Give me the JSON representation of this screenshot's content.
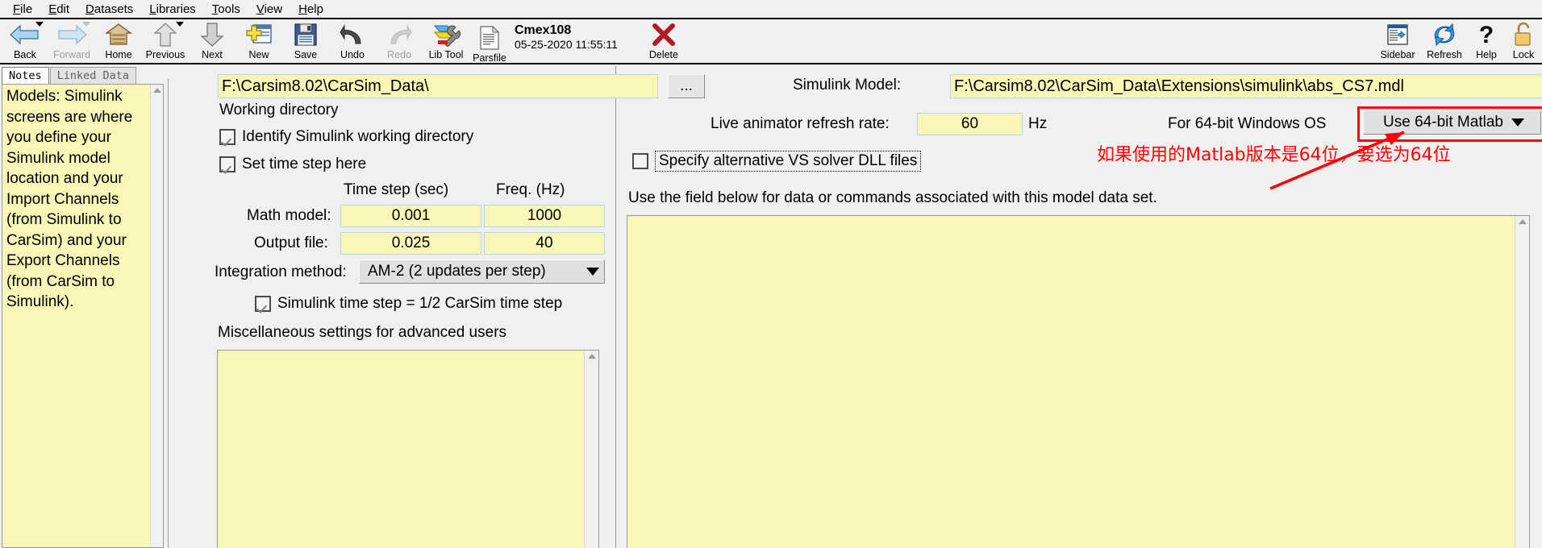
{
  "menu": {
    "items": [
      {
        "label": "File",
        "mnemonic": "F"
      },
      {
        "label": "Edit",
        "mnemonic": "E"
      },
      {
        "label": "Datasets",
        "mnemonic": "D"
      },
      {
        "label": "Libraries",
        "mnemonic": "L"
      },
      {
        "label": "Tools",
        "mnemonic": "T"
      },
      {
        "label": "View",
        "mnemonic": "V"
      },
      {
        "label": "Help",
        "mnemonic": "H"
      }
    ]
  },
  "toolbar": {
    "buttons": [
      {
        "label": "Back",
        "icon": "back-arrow-icon",
        "enabled": true,
        "caret": true
      },
      {
        "label": "Forward",
        "icon": "forward-arrow-icon",
        "enabled": false,
        "caret": true
      },
      {
        "label": "Home",
        "icon": "home-icon",
        "enabled": true,
        "caret": false
      },
      {
        "label": "Previous",
        "icon": "up-arrow-icon",
        "enabled": true,
        "caret": true
      },
      {
        "label": "Next",
        "icon": "down-arrow-icon",
        "enabled": true,
        "caret": false
      },
      {
        "label": "New",
        "icon": "new-dataset-icon",
        "enabled": true,
        "caret": false
      },
      {
        "label": "Save",
        "icon": "floppy-disk-icon",
        "enabled": true,
        "caret": false
      },
      {
        "label": "Undo",
        "icon": "undo-arrow-icon",
        "enabled": true,
        "caret": false
      },
      {
        "label": "Redo",
        "icon": "redo-arrow-icon",
        "enabled": false,
        "caret": false
      },
      {
        "label": "Lib Tool",
        "icon": "library-tool-icon",
        "enabled": true,
        "caret": false
      }
    ],
    "parsfile": {
      "label": "Parsfile",
      "icon": "document-icon",
      "name": "Cmex108",
      "date": "05-25-2020 11:55:11"
    },
    "delete": {
      "label": "Delete",
      "icon": "red-x-icon"
    },
    "right_buttons": [
      {
        "label": "Sidebar",
        "icon": "sidebar-icon"
      },
      {
        "label": "Refresh",
        "icon": "refresh-icon"
      },
      {
        "label": "Help",
        "icon": "question-mark-icon"
      },
      {
        "label": "Lock",
        "icon": "padlock-open-icon"
      }
    ]
  },
  "notes": {
    "tabs": [
      {
        "label": "Notes",
        "active": true
      },
      {
        "label": "Linked Data",
        "active": false
      }
    ],
    "text": "Models: Simulink screens are where you define your Simulink model location and your Import Channels (from Simulink to CarSim) and your Export Channels (from CarSim to Simulink)."
  },
  "left_panel": {
    "working_directory": {
      "value": "F:\\Carsim8.02\\CarSim_Data\\",
      "caption": "Working directory",
      "browse_label": "..."
    },
    "identify_simulink_wd": {
      "label": "Identify Simulink working directory",
      "checked": true
    },
    "set_time_step": {
      "label": "Set time step here",
      "checked": true
    },
    "time_table": {
      "headers": [
        "Time step (sec)",
        "Freq. (Hz)"
      ],
      "rows": [
        {
          "label": "Math model:",
          "time_step": "0.001",
          "freq": "1000"
        },
        {
          "label": "Output file:",
          "time_step": "0.025",
          "freq": "40"
        }
      ]
    },
    "integration_method": {
      "label": "Integration method:",
      "value": "AM-2 (2 updates per step)"
    },
    "simulink_half_step": {
      "label": "Simulink time step = 1/2 CarSim time step",
      "checked": true
    },
    "misc_settings": {
      "label": "Miscellaneous settings for advanced users",
      "value": ""
    }
  },
  "right_panel": {
    "simulink_model": {
      "label": "Simulink Model:",
      "value": "F:\\Carsim8.02\\CarSim_Data\\Extensions\\simulink\\abs_CS7.mdl",
      "browse_label": "..."
    },
    "refresh_rate": {
      "label": "Live animator refresh rate:",
      "value": "60",
      "unit": "Hz"
    },
    "matlab_os": {
      "label": "For 64-bit Windows OS",
      "value": "Use 64-bit Matlab"
    },
    "alt_dll": {
      "label": "Specify alternative VS solver DLL files",
      "checked": false
    },
    "data_field": {
      "label": "Use the field below  for data or commands associated with this model data set.",
      "value": ""
    }
  },
  "annotation": {
    "text": "如果使用的Matlab版本是64位，要选为64位",
    "color": "#ff0000"
  },
  "colors": {
    "field_yellow": "#f8f7b8",
    "window_gray": "#f0f0f0",
    "annotation_red": "#ff0000",
    "field_border": "#b9d4e8"
  }
}
